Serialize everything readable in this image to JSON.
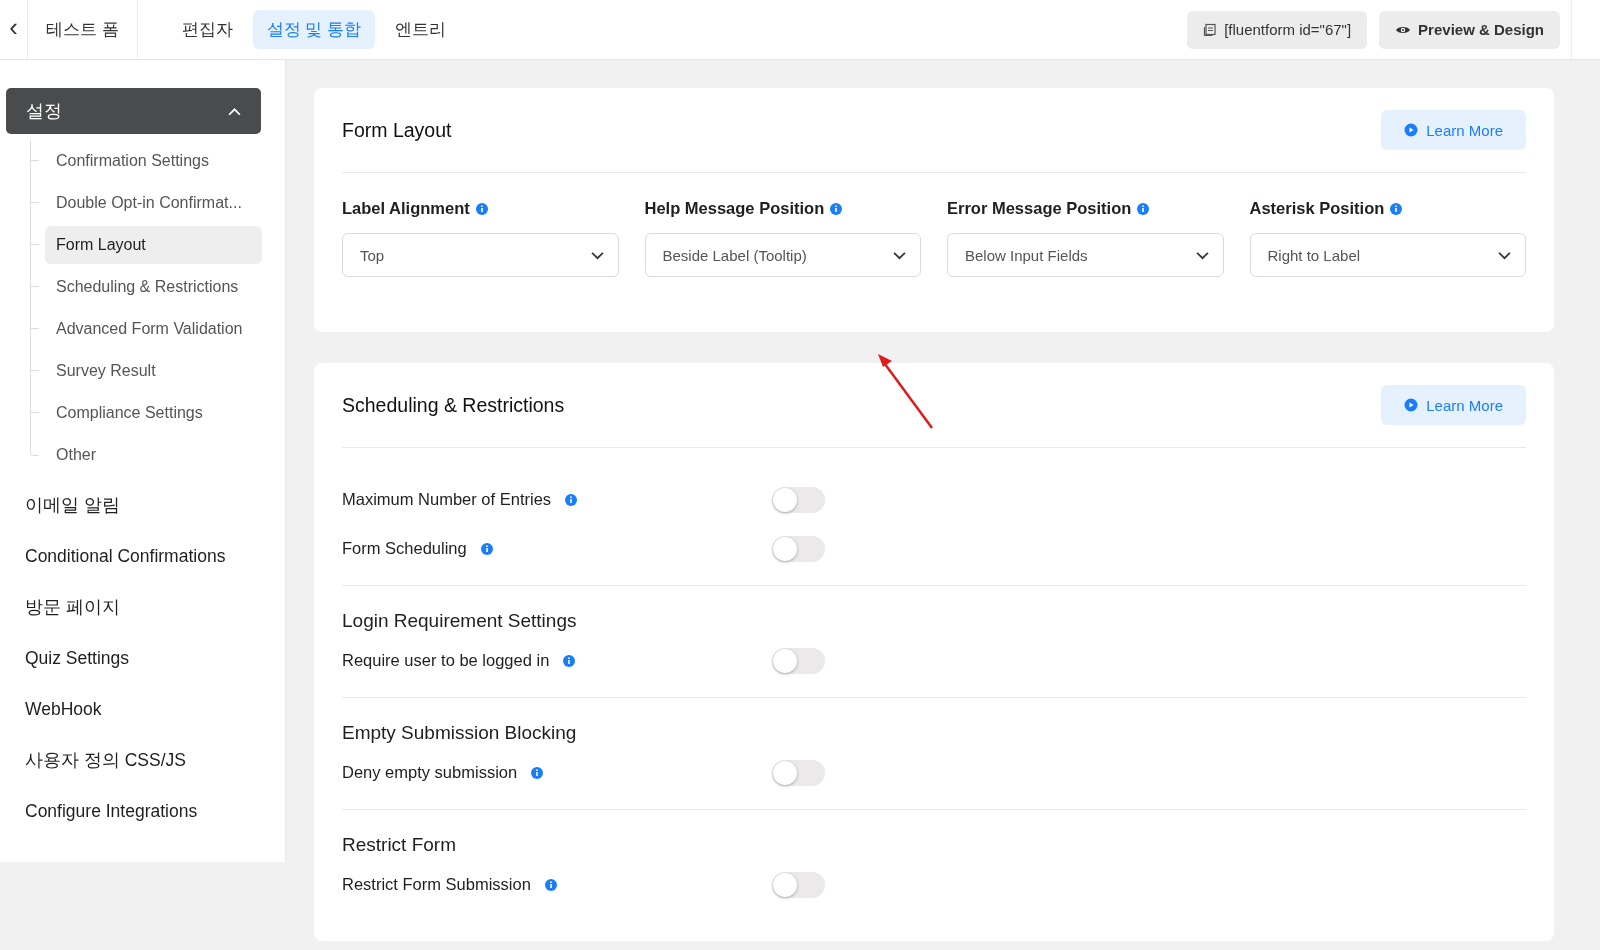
{
  "header": {
    "back": "‹",
    "form_name": "테스트 폼",
    "tabs": [
      {
        "label": "편집자",
        "selected": false
      },
      {
        "label": "설정 및 통합",
        "selected": true
      },
      {
        "label": "엔트리",
        "selected": false
      }
    ],
    "shortcode": "[fluentform id=\"67\"]",
    "preview": "Preview & Design"
  },
  "sidebar": {
    "group": {
      "label": "설정",
      "expanded": true,
      "items": [
        {
          "label": "Confirmation Settings",
          "selected": false
        },
        {
          "label": "Double Opt-in Confirmat...",
          "selected": false
        },
        {
          "label": "Form Layout",
          "selected": true
        },
        {
          "label": "Scheduling & Restrictions",
          "selected": false
        },
        {
          "label": "Advanced Form Validation",
          "selected": false
        },
        {
          "label": "Survey Result",
          "selected": false
        },
        {
          "label": "Compliance Settings",
          "selected": false
        },
        {
          "label": "Other",
          "selected": false
        }
      ]
    },
    "items": [
      "이메일 알림",
      "Conditional Confirmations",
      "방문 페이지",
      "Quiz Settings",
      "WebHook",
      "사용자 정의 CSS/JS",
      "Configure Integrations"
    ]
  },
  "form_layout": {
    "title": "Form Layout",
    "learn_more": "Learn More",
    "fields": [
      {
        "label": "Label Alignment",
        "value": "Top"
      },
      {
        "label": "Help Message Position",
        "value": "Beside Label (Tooltip)"
      },
      {
        "label": "Error Message Position",
        "value": "Below Input Fields"
      },
      {
        "label": "Asterisk Position",
        "value": "Right to Label"
      }
    ]
  },
  "scheduling": {
    "title": "Scheduling & Restrictions",
    "learn_more": "Learn More",
    "sections": [
      {
        "toggles": [
          {
            "label": "Maximum Number of Entries",
            "on": false
          },
          {
            "label": "Form Scheduling",
            "on": false
          }
        ]
      },
      {
        "title": "Login Requirement Settings",
        "toggles": [
          {
            "label": "Require user to be logged in",
            "on": false
          }
        ]
      },
      {
        "title": "Empty Submission Blocking",
        "toggles": [
          {
            "label": "Deny empty submission",
            "on": false
          }
        ]
      },
      {
        "title": "Restrict Form",
        "toggles": [
          {
            "label": "Restrict Form Submission",
            "on": false
          }
        ]
      }
    ]
  }
}
